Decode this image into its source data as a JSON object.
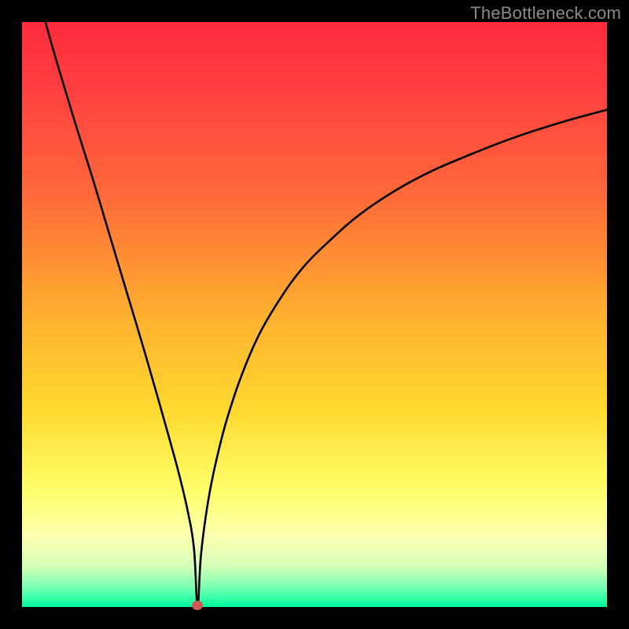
{
  "attribution": "TheBottleneck.com",
  "colors": {
    "border": "#000000",
    "gradient_stops": [
      {
        "offset": 0.0,
        "color": "#ff2b3d"
      },
      {
        "offset": 0.12,
        "color": "#ff4141"
      },
      {
        "offset": 0.3,
        "color": "#ff6b3a"
      },
      {
        "offset": 0.5,
        "color": "#ffb02f"
      },
      {
        "offset": 0.66,
        "color": "#ffd92f"
      },
      {
        "offset": 0.8,
        "color": "#ffff6a"
      },
      {
        "offset": 0.88,
        "color": "#fbffb0"
      },
      {
        "offset": 0.93,
        "color": "#d6ffb8"
      },
      {
        "offset": 0.965,
        "color": "#7dffb4"
      },
      {
        "offset": 1.0,
        "color": "#00ff9c"
      }
    ],
    "curve": "#000000",
    "marker": "#cc5a56"
  },
  "chart_data": {
    "type": "line",
    "title": "",
    "xlabel": "",
    "ylabel": "",
    "xlim": [
      0,
      100
    ],
    "ylim": [
      0,
      100
    ],
    "grid": false,
    "legend": false,
    "notes": "Axes carry no tick labels in the source image; values are read in percent of plot width/height. Single black curve dropping from top-left to a minimum near x≈30% at the baseline, then rising with decreasing slope toward the right edge, topping near y≈85% at x=100%. A single red dot marks the minimum.",
    "marker": {
      "x": 30,
      "y": 0
    },
    "series": [
      {
        "name": "curve",
        "x_pct": [
          4,
          6,
          9,
          12,
          15,
          18,
          21,
          24,
          26.5,
          28.2,
          29.4,
          30,
          30.6,
          31.8,
          33.2,
          35,
          37.5,
          40.5,
          44,
          48,
          53,
          58,
          64,
          70,
          77,
          84,
          92,
          100
        ],
        "y_pct": [
          100,
          93,
          83,
          73.5,
          63.5,
          53.5,
          43.5,
          33,
          24,
          17,
          10,
          0,
          9,
          18,
          25,
          32,
          39.5,
          46.5,
          52.5,
          58,
          63,
          67.3,
          71.3,
          74.5,
          77.5,
          80.2,
          82.8,
          85
        ]
      }
    ]
  }
}
